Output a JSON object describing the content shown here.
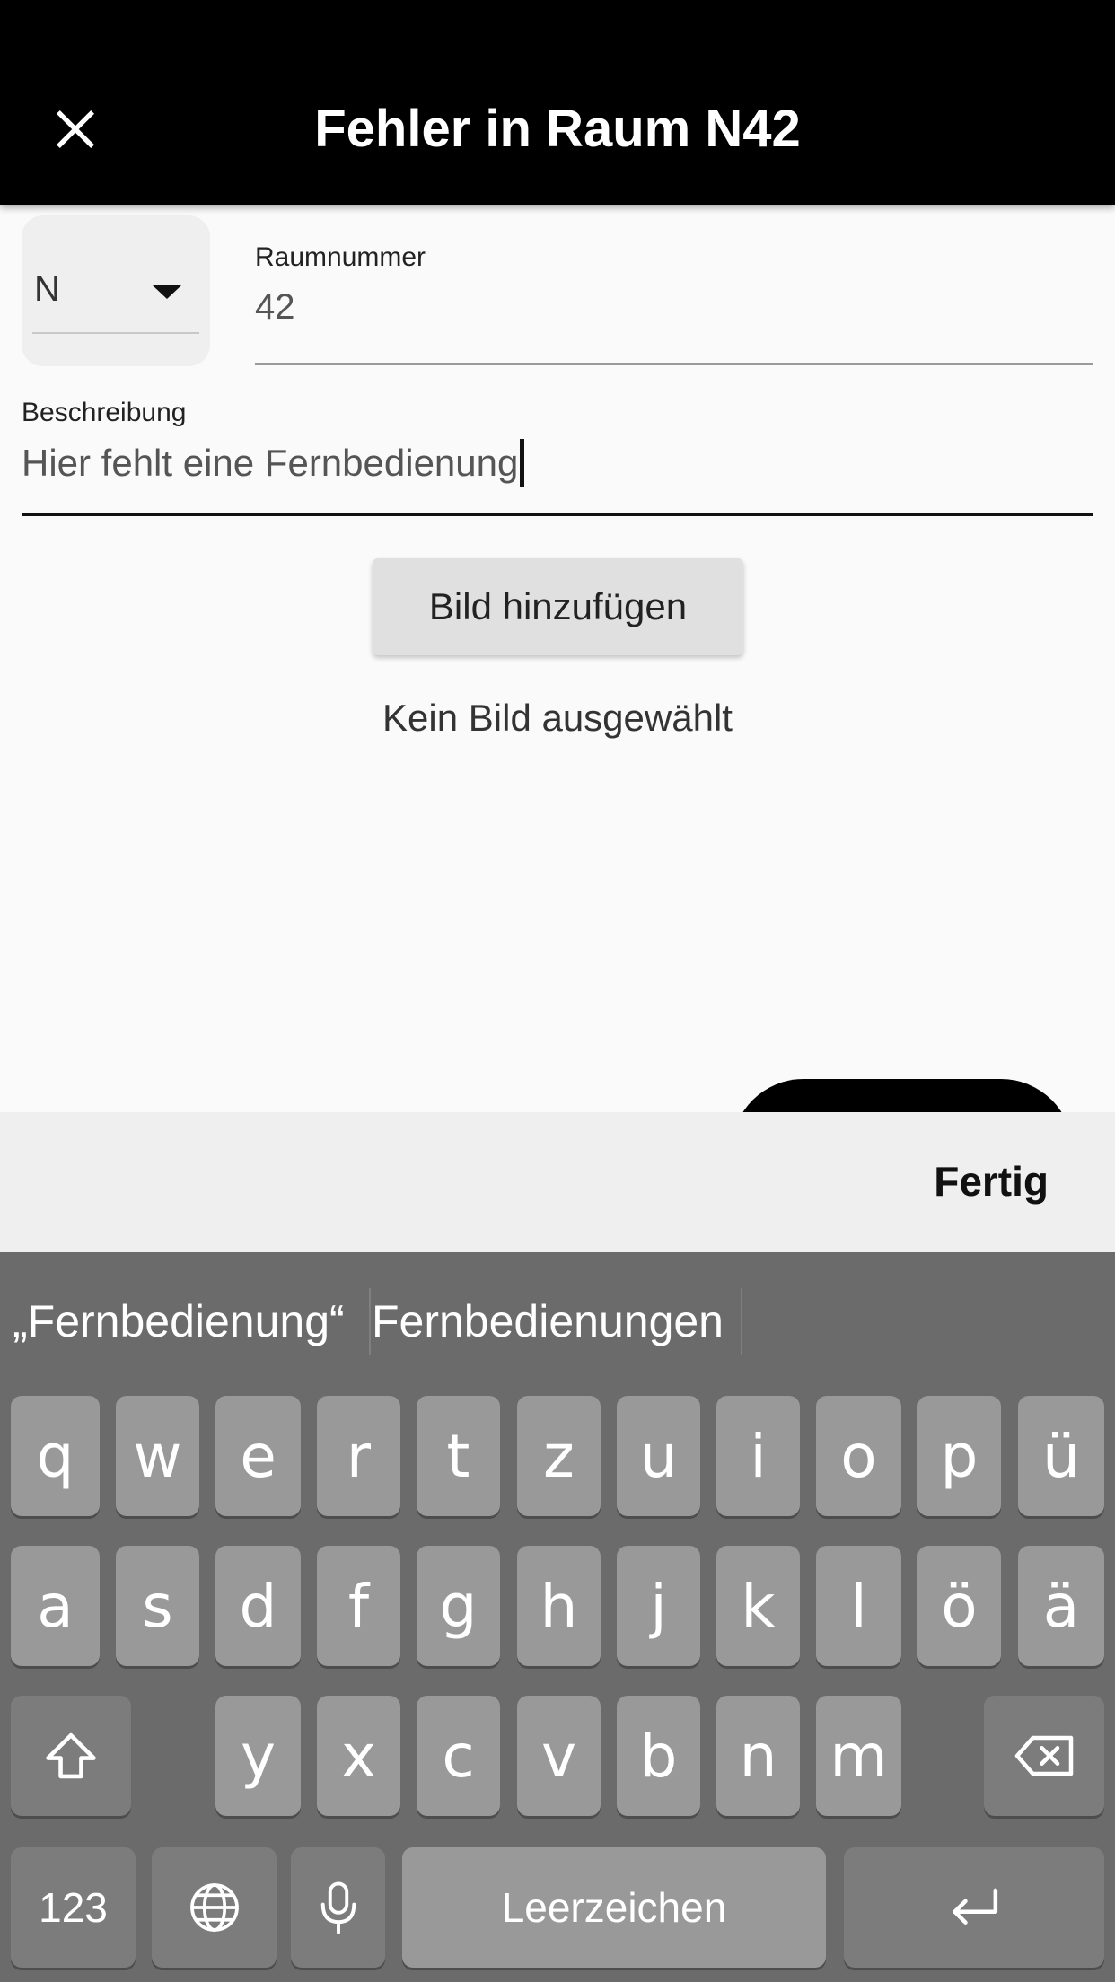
{
  "appbar": {
    "title": "Fehler in Raum N42",
    "close_icon": "close-icon"
  },
  "form": {
    "building_dropdown": {
      "selected": "N",
      "icon": "arrow-drop-down-icon"
    },
    "room_number": {
      "label": "Raumnummer",
      "value": "42"
    },
    "description": {
      "label": "Beschreibung",
      "value": "Hier fehlt eine Fernbedienung"
    },
    "add_image_button": "Bild hinzufügen",
    "no_image_text": "Kein Bild ausgewählt"
  },
  "accessory_bar": {
    "done_label": "Fertig"
  },
  "keyboard": {
    "suggestions": [
      "„Fernbedienung“",
      "Fernbedienungen",
      ""
    ],
    "rows": [
      [
        "q",
        "w",
        "e",
        "r",
        "t",
        "z",
        "u",
        "i",
        "o",
        "p",
        "ü"
      ],
      [
        "a",
        "s",
        "d",
        "f",
        "g",
        "h",
        "j",
        "k",
        "l",
        "ö",
        "ä"
      ],
      [
        "y",
        "x",
        "c",
        "v",
        "b",
        "n",
        "m"
      ]
    ],
    "numbers_label": "123",
    "space_label": "Leerzeichen",
    "shift_icon": "shift-icon",
    "backspace_icon": "backspace-icon",
    "globe_icon": "globe-icon",
    "mic_icon": "microphone-icon",
    "return_icon": "return-icon"
  }
}
